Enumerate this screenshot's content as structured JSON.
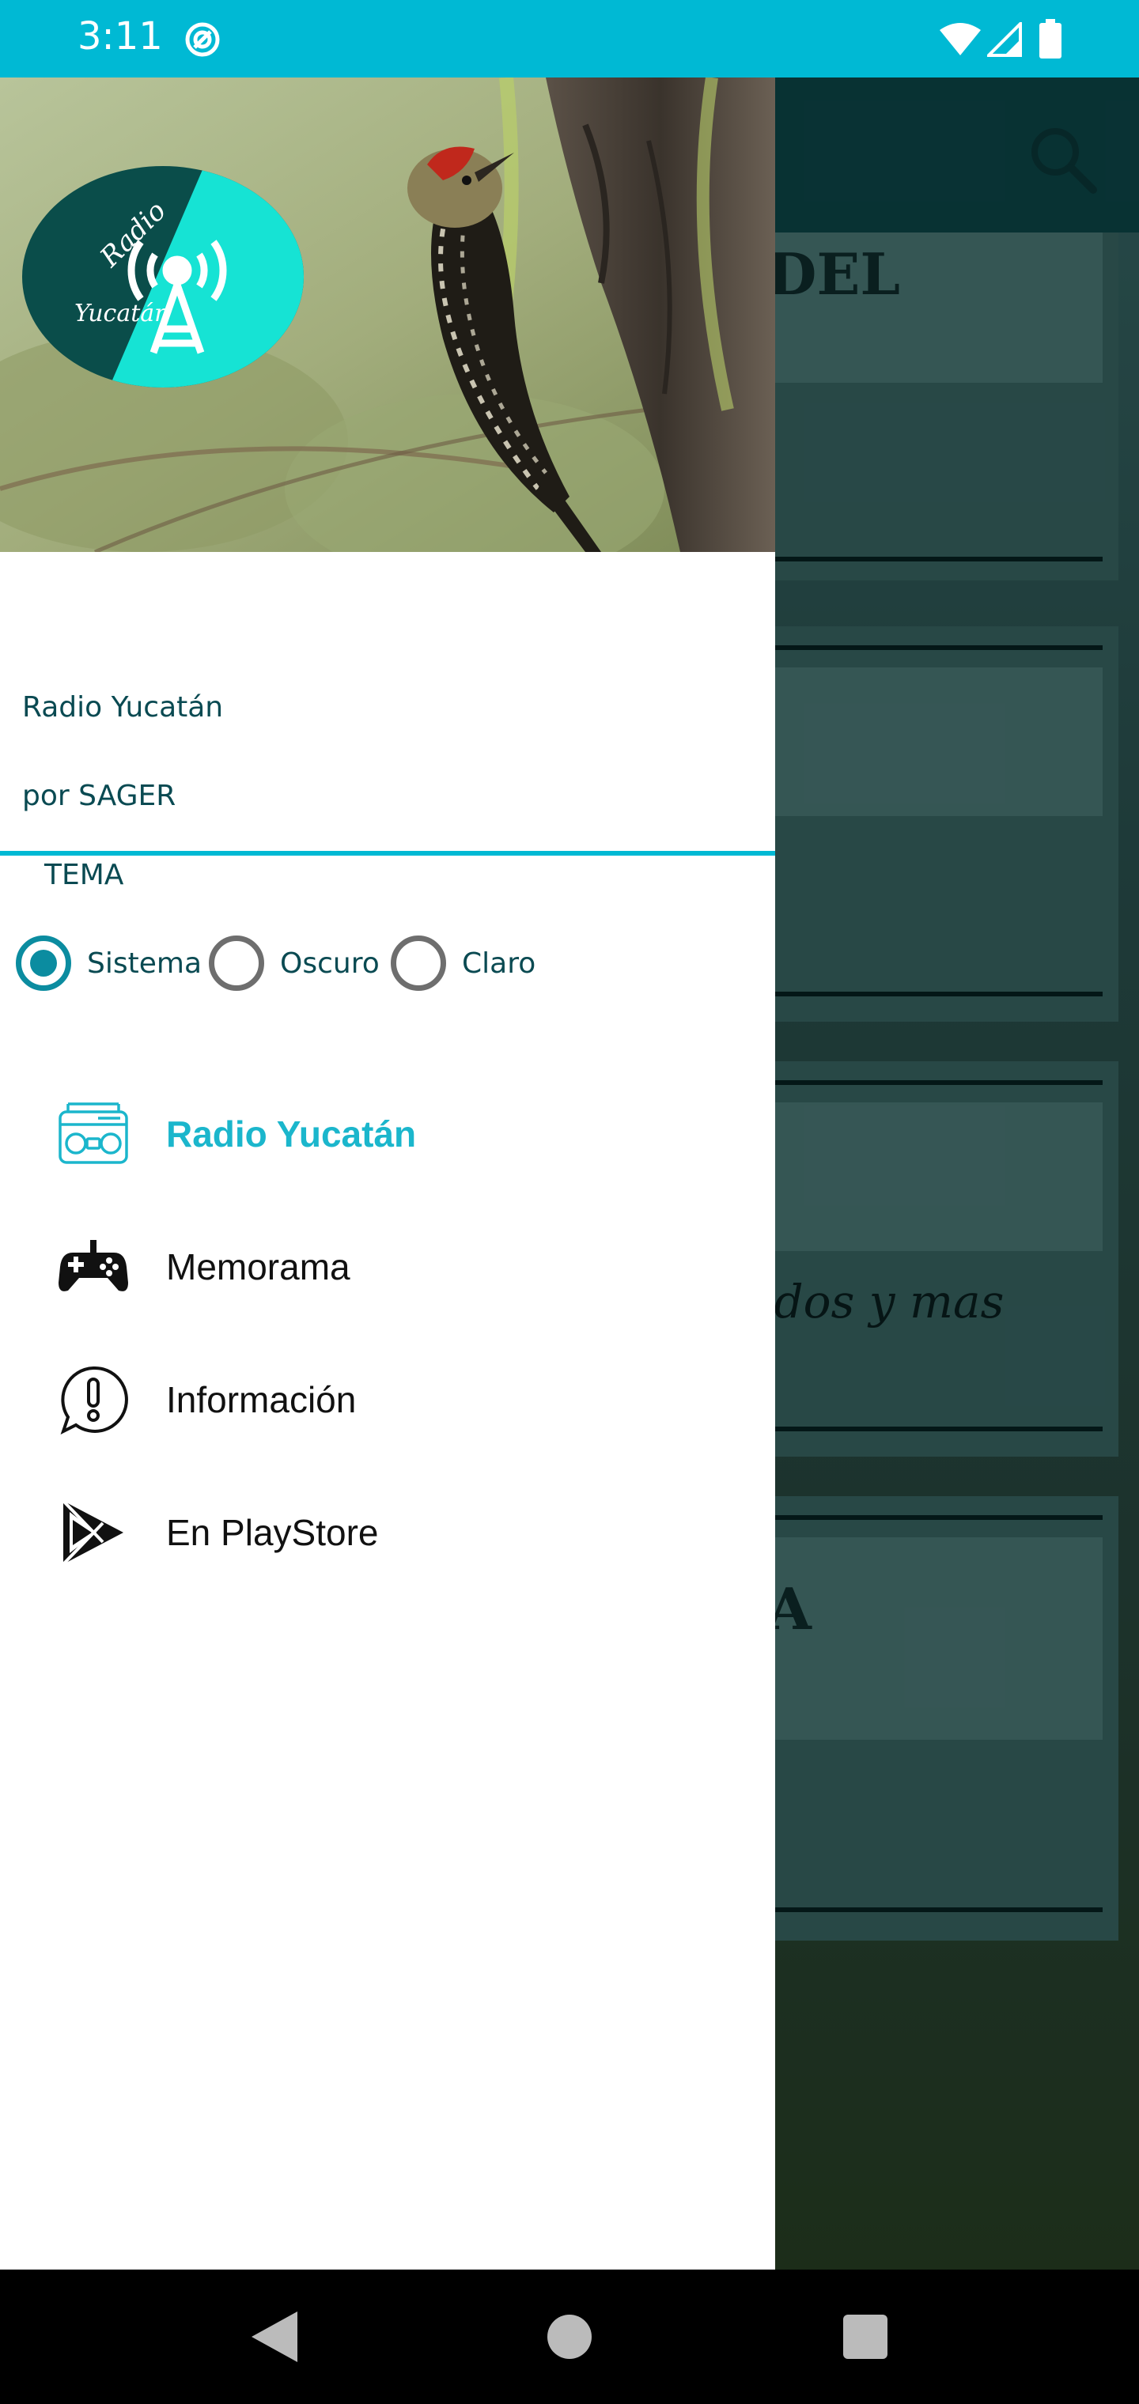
{
  "status_bar": {
    "time": "3:11",
    "icons": [
      "do-not-disturb-icon",
      "wifi-icon",
      "signal-icon",
      "battery-icon"
    ]
  },
  "background": {
    "cards": [
      {
        "text": "DEL"
      },
      {
        "text": ""
      },
      {
        "text": "idos y mas"
      },
      {
        "text": "A"
      }
    ],
    "colors": {
      "app_bar": "#0d4a4c",
      "card": "#3b6a68"
    }
  },
  "drawer": {
    "logo": {
      "line1": "Radio",
      "line2": "Yucatán"
    },
    "app_name": "Radio Yucatán",
    "app_author": "por SAGER",
    "theme": {
      "label": "TEMA",
      "options": [
        {
          "label": "Sistema",
          "selected": true
        },
        {
          "label": "Oscuro",
          "selected": false
        },
        {
          "label": "Claro",
          "selected": false
        }
      ]
    },
    "menu": [
      {
        "label": "Radio Yucatán",
        "icon": "radio-icon",
        "active": true
      },
      {
        "label": "Memorama",
        "icon": "gamepad-icon",
        "active": false
      },
      {
        "label": "Información",
        "icon": "info-chat-icon",
        "active": false
      },
      {
        "label": "En PlayStore",
        "icon": "play-store-icon",
        "active": false
      }
    ]
  },
  "colors": {
    "accent": "#00b9d4",
    "active_item": "#1bb6cc",
    "radio_checked": "#0b8ca0",
    "text_primary": "#0a4a52"
  },
  "nav_bar": {
    "buttons": [
      "back-icon",
      "home-icon",
      "recents-icon"
    ]
  }
}
